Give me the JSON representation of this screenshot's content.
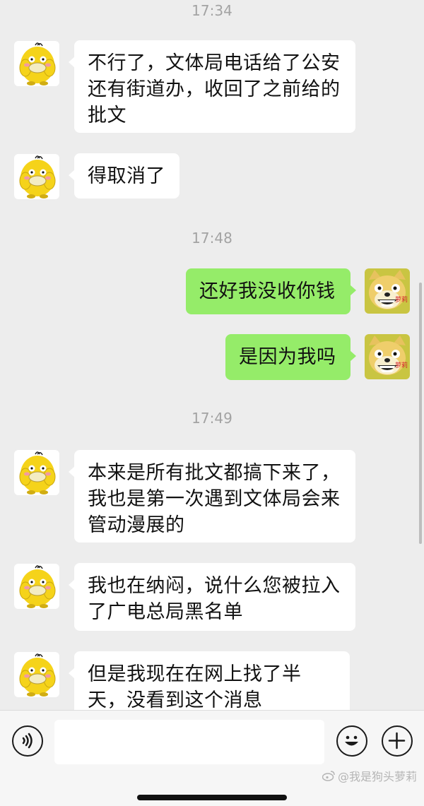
{
  "messages": {
    "time_1": "17:34",
    "m1": "不行了，文体局电话给了公安还有街道办，收回了之前给的批文",
    "m2": "得取消了",
    "time_2": "17:48",
    "m3": "还好我没收你钱",
    "m4": "是因为我吗",
    "time_3": "17:49",
    "m5": "本来是所有批文都搞下来了，我也是第一次遇到文体局会来管动漫展的",
    "m6": "我也在纳闷，说什么您被拉入了广电总局黑名单",
    "m7": "但是我现在在网上找了半天，没看到这个消息"
  },
  "avatars": {
    "contact_icon": "yellow-duck-avatar",
    "self_icon": "shiba-dog-avatar",
    "self_badge": "萝莉"
  },
  "input_bar": {
    "voice_icon": "voice-icon",
    "emoji_icon": "emoji-icon",
    "plus_icon": "plus-icon"
  },
  "watermark": "@我是狗头萝莉",
  "colors": {
    "background": "#ededed",
    "incoming_bubble": "#ffffff",
    "outgoing_bubble": "#95ec69",
    "timestamp": "#a3a3a3"
  }
}
